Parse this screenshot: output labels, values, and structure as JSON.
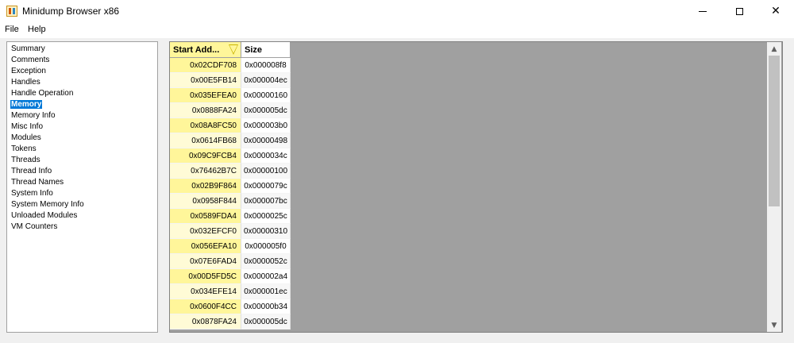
{
  "window": {
    "title": "Minidump Browser x86"
  },
  "menu": {
    "items": [
      "File",
      "Help"
    ]
  },
  "tree": {
    "items": [
      "Summary",
      "Comments",
      "Exception",
      "Handles",
      "Handle Operation",
      "Memory",
      "Memory Info",
      "Misc Info",
      "Modules",
      "Tokens",
      "Threads",
      "Thread Info",
      "Thread Names",
      "System Info",
      "System Memory Info",
      "Unloaded Modules",
      "VM Counters"
    ],
    "selected": "Memory"
  },
  "grid": {
    "columns": {
      "start": "Start Add...",
      "size": "Size"
    },
    "sort_column": "start",
    "rows": [
      {
        "start": "0x02CDF708",
        "size": "0x000008f8"
      },
      {
        "start": "0x00E5FB14",
        "size": "0x000004ec"
      },
      {
        "start": "0x035EFEA0",
        "size": "0x00000160"
      },
      {
        "start": "0x0888FA24",
        "size": "0x000005dc"
      },
      {
        "start": "0x08A8FC50",
        "size": "0x000003b0"
      },
      {
        "start": "0x0614FB68",
        "size": "0x00000498"
      },
      {
        "start": "0x09C9FCB4",
        "size": "0x0000034c"
      },
      {
        "start": "0x76462B7C",
        "size": "0x00000100"
      },
      {
        "start": "0x02B9F864",
        "size": "0x0000079c"
      },
      {
        "start": "0x0958F844",
        "size": "0x000007bc"
      },
      {
        "start": "0x0589FDA4",
        "size": "0x0000025c"
      },
      {
        "start": "0x032EFCF0",
        "size": "0x00000310"
      },
      {
        "start": "0x056EFA10",
        "size": "0x000005f0"
      },
      {
        "start": "0x07E6FAD4",
        "size": "0x0000052c"
      },
      {
        "start": "0x00D5FD5C",
        "size": "0x000002a4"
      },
      {
        "start": "0x034EFE14",
        "size": "0x000001ec"
      },
      {
        "start": "0x0600F4CC",
        "size": "0x00000b34"
      },
      {
        "start": "0x0878FA24",
        "size": "0x000005dc"
      }
    ]
  },
  "icons": {
    "app": "minidump-app-icon",
    "minimize": "minimize-icon",
    "maximize": "maximize-icon",
    "close": "close-icon",
    "scroll_up": "scroll-up-icon",
    "scroll_down": "scroll-down-icon",
    "sort": "sort-descending-icon"
  }
}
